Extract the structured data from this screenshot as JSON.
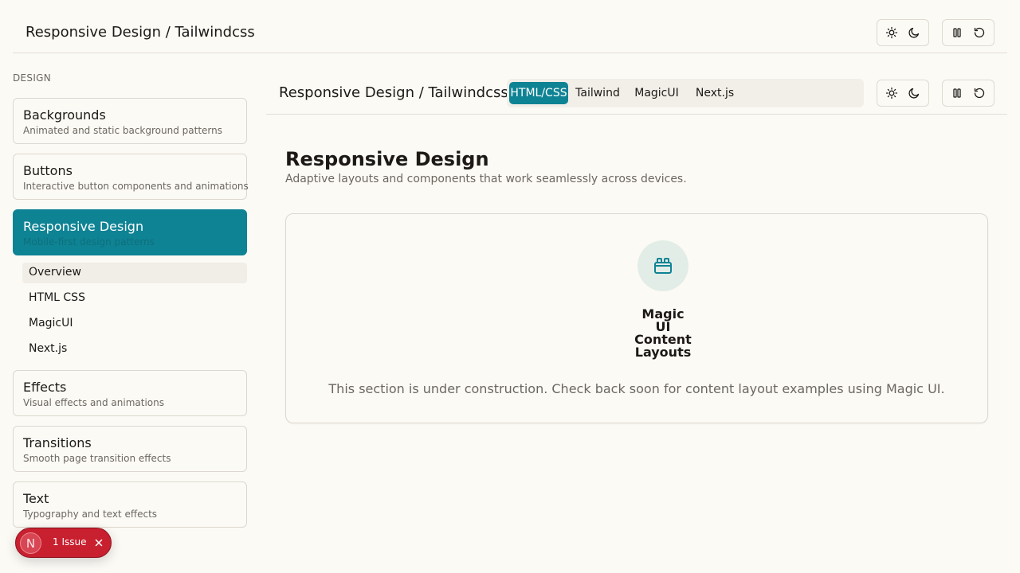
{
  "top_header": {
    "title": "Responsive Design / Tailwindcss"
  },
  "sidebar": {
    "heading": "DESIGN",
    "cards": [
      {
        "title": "Backgrounds",
        "subtitle": "Animated and static background patterns"
      },
      {
        "title": "Buttons",
        "subtitle": "Interactive button components and animations"
      },
      {
        "title": "Responsive Design",
        "subtitle": "Mobile-first design patterns",
        "active": true
      },
      {
        "title": "Effects",
        "subtitle": "Visual effects and animations"
      },
      {
        "title": "Transitions",
        "subtitle": "Smooth page transition effects"
      },
      {
        "title": "Text",
        "subtitle": "Typography and text effects"
      }
    ],
    "sub_items": [
      "Overview",
      "HTML CSS",
      "MagicUI",
      "Next.js"
    ],
    "selected_sub_item": "Overview"
  },
  "main_header": {
    "title": "Responsive Design / Tailwindcss",
    "tabs": [
      "HTML/CSS",
      "Tailwind",
      "MagicUI",
      "Next.js"
    ],
    "active_tab": "HTML/CSS"
  },
  "content": {
    "title": "Responsive Design",
    "description": "Adaptive layouts and components that work seamlessly across devices.",
    "card_heading_lines": [
      "Magic",
      "UI",
      "Content",
      "Layouts"
    ],
    "card_text": "This section is under construction. Check back soon for content layout examples using Magic UI."
  },
  "issue_badge": {
    "avatar_letter": "N",
    "label": "1 Issue"
  },
  "icons": {
    "sun": "sun-icon",
    "moon": "moon-icon",
    "pause": "pause-icon",
    "reset": "reset-icon",
    "content": "layout-blocks-icon",
    "close": "close-icon"
  },
  "colors": {
    "accent": "#0e8394",
    "background": "#fcfaf5",
    "issue_red": "#c8202f",
    "muted_text": "#6b6760"
  }
}
